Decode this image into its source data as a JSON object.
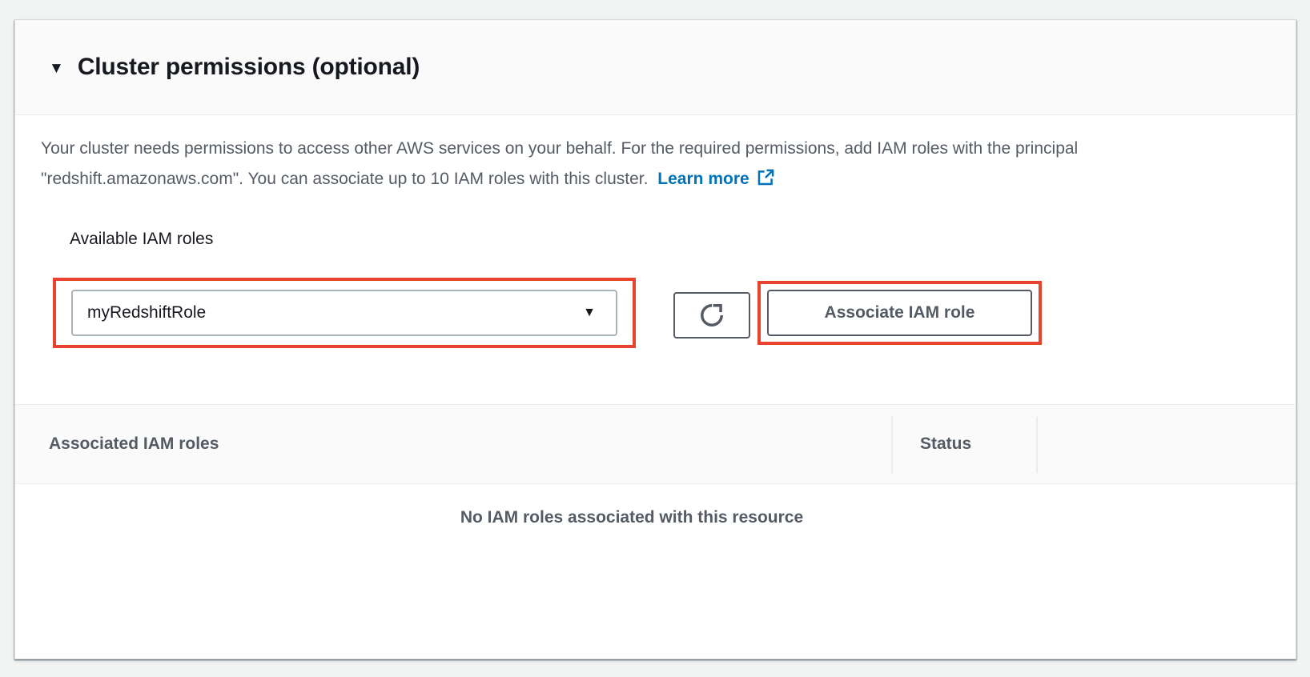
{
  "section": {
    "collapse_icon": "▼",
    "title": "Cluster permissions (optional)",
    "description_line1": "Your cluster needs permissions to access other AWS services on your behalf. For the required permissions, add IAM roles with the principal",
    "description_line2": "\"redshift.amazonaws.com\". You can associate up to 10 IAM roles with this cluster.",
    "learn_more_label": "Learn more"
  },
  "form": {
    "available_roles_label": "Available IAM roles",
    "role_select": {
      "value": "myRedshiftRole",
      "dropdown_icon": "▼"
    },
    "associate_button_label": "Associate IAM role"
  },
  "table": {
    "columns": [
      {
        "label": "Associated IAM roles"
      },
      {
        "label": "Status"
      }
    ],
    "rows": [],
    "empty_message": "No IAM roles associated with this resource"
  },
  "icons": {
    "collapse_triangle": "▼ solid down triangle",
    "select_caret": "▼ solid down triangle",
    "refresh": "circular clockwise arrow",
    "external_link": "box with outgoing arrow"
  },
  "colors": {
    "annotation_highlight": "#e8432d",
    "link": "#0073bb",
    "heading_text": "#16191f",
    "body_text": "#545b64",
    "panel_header_bg": "#fafafa",
    "page_bg": "#f2f3f3",
    "border": "#eaeded"
  }
}
